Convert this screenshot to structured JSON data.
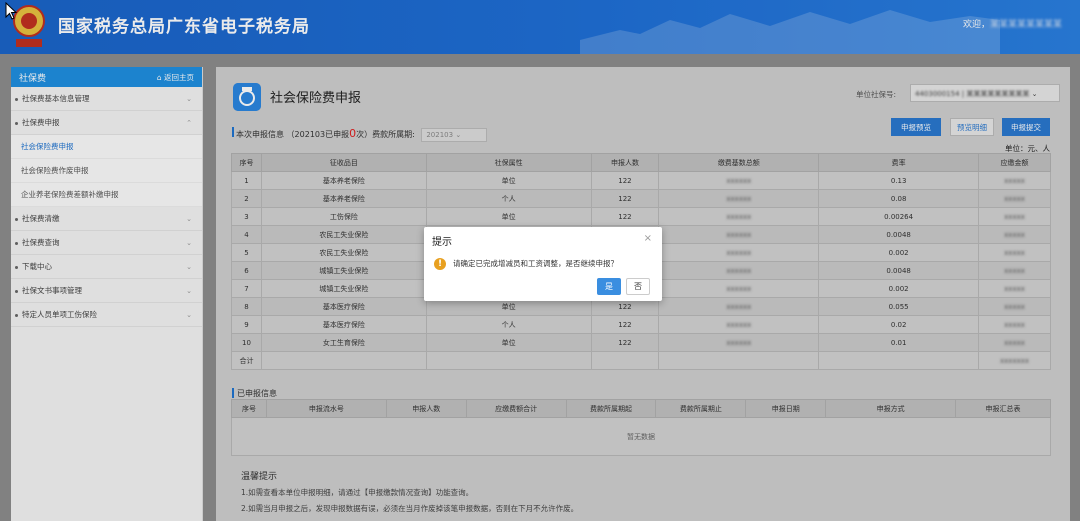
{
  "header": {
    "title": "国家税务总局广东省电子税务局",
    "welcome": "欢迎，",
    "welcome_name": "某某某某某某某某"
  },
  "sidebar": {
    "title": "社保费",
    "home_link": "返回主页",
    "items": [
      {
        "label": "社保费基本信息管理"
      },
      {
        "label": "社保费申报"
      },
      {
        "label": "社保费清缴"
      },
      {
        "label": "社保费查询"
      },
      {
        "label": "下载中心"
      },
      {
        "label": "社保文书事项管理"
      },
      {
        "label": "特定人员单项工伤保险"
      }
    ],
    "subitems": [
      {
        "label": "社会保险费申报"
      },
      {
        "label": "社会保险费作废申报"
      },
      {
        "label": "企业养老保险费差额补缴申报"
      }
    ]
  },
  "main": {
    "title": "社会保险费申报",
    "unit_label": "单位社保号:",
    "unit_value": "4403000154 | 某某某某某某某某某",
    "info_prefix": "本次申报信息",
    "info_mid": "（202103已申报",
    "info_count": "0",
    "info_suffix": "次）",
    "period_label": "费款所属期:",
    "period_value": "202103",
    "buttons": {
      "preview": "申报预览",
      "detail": "预览明细",
      "submit": "申报提交"
    },
    "unit_text": "单位：元、人",
    "table_headers": [
      "序号",
      "征收品目",
      "社保属性",
      "申报人数",
      "缴费基数总额",
      "费率",
      "应缴金额"
    ],
    "rows": [
      {
        "no": "1",
        "item": "基本养老保险",
        "attr": "单位",
        "count": "122",
        "base": "xxxxxx",
        "rate": "0.13",
        "amount": "xxxxx"
      },
      {
        "no": "2",
        "item": "基本养老保险",
        "attr": "个人",
        "count": "122",
        "base": "xxxxxx",
        "rate": "0.08",
        "amount": "xxxxx"
      },
      {
        "no": "3",
        "item": "工伤保险",
        "attr": "单位",
        "count": "122",
        "base": "xxxxxx",
        "rate": "0.00264",
        "amount": "xxxxx"
      },
      {
        "no": "4",
        "item": "农民工失业保险",
        "attr": "",
        "count": "",
        "base": "xxxxxx",
        "rate": "0.0048",
        "amount": "xxxxx"
      },
      {
        "no": "5",
        "item": "农民工失业保险",
        "attr": "",
        "count": "",
        "base": "xxxxxx",
        "rate": "0.002",
        "amount": "xxxxx"
      },
      {
        "no": "6",
        "item": "城镇工失业保险",
        "attr": "",
        "count": "",
        "base": "xxxxxx",
        "rate": "0.0048",
        "amount": "xxxxx"
      },
      {
        "no": "7",
        "item": "城镇工失业保险",
        "attr": "",
        "count": "",
        "base": "xxxxxx",
        "rate": "0.002",
        "amount": "xxxxx"
      },
      {
        "no": "8",
        "item": "基本医疗保险",
        "attr": "单位",
        "count": "122",
        "base": "xxxxxx",
        "rate": "0.055",
        "amount": "xxxxx"
      },
      {
        "no": "9",
        "item": "基本医疗保险",
        "attr": "个人",
        "count": "122",
        "base": "xxxxxx",
        "rate": "0.02",
        "amount": "xxxxx"
      },
      {
        "no": "10",
        "item": "女工生育保险",
        "attr": "单位",
        "count": "122",
        "base": "xxxxxx",
        "rate": "0.01",
        "amount": "xxxxx"
      }
    ],
    "total_label": "合计",
    "total_amount": "xxxxxxx",
    "declared_title": "已申报信息",
    "declared_headers": [
      "序号",
      "申报流水号",
      "申报人数",
      "应缴费额合计",
      "费款所属期起",
      "费款所属期止",
      "申报日期",
      "申报方式",
      "申报汇总表"
    ],
    "no_data": "暂无数据",
    "tips_title": "温馨提示",
    "tips": [
      "1.如需查看本单位申报明细，请通过【申报缴款情况查询】功能查询。",
      "2.如需当月申报之后，发现申报数据有误，必须在当月作废掉该笔申报数据，否则在下月不允许作废。"
    ]
  },
  "modal": {
    "title": "提示",
    "close": "×",
    "message": "请确定已完成增减员和工资调整，是否继续申报？",
    "yes": "是",
    "no": "否"
  },
  "colors": {
    "header_blue": "#1b64c8",
    "accent_blue": "#2a78cf",
    "warn_orange": "#e8a020",
    "count_red": "#e02020"
  }
}
